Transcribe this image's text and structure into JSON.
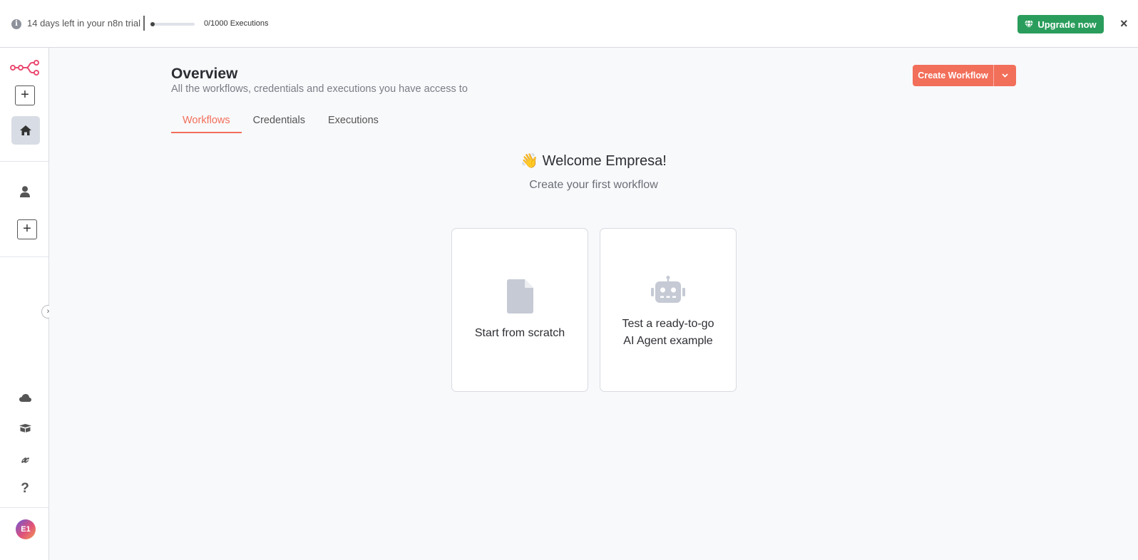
{
  "banner": {
    "trial_text": "14 days left in your n8n trial",
    "executions_text": "0/1000 Executions",
    "executions_used_fraction": 0.0,
    "upgrade_label": "Upgrade now",
    "close_label": "×",
    "upgrade_color": "#2a9d5c"
  },
  "sidebar": {
    "logo_icon": "n8n-logo-icon",
    "items": [
      {
        "icon": "plus-icon"
      },
      {
        "icon": "home-icon"
      },
      {
        "icon": "user-icon"
      },
      {
        "icon": "plus-icon"
      },
      {
        "icon": "cloud-icon"
      },
      {
        "icon": "package-icon"
      },
      {
        "icon": "variable-icon"
      },
      {
        "icon": "help-icon"
      }
    ],
    "avatar_initials": "E1"
  },
  "header": {
    "title": "Overview",
    "subtitle": "All the workflows, credentials and executions you have access to",
    "create_label": "Create Workflow",
    "accent_color": "#f26f5a"
  },
  "tabs": [
    {
      "label": "Workflows",
      "active": true
    },
    {
      "label": "Credentials",
      "active": false
    },
    {
      "label": "Executions",
      "active": false
    }
  ],
  "welcome": {
    "title": "👋 Welcome Empresa!",
    "subtitle": "Create your first workflow"
  },
  "cards": [
    {
      "line1": "Start from scratch",
      "icon": "file-icon"
    },
    {
      "line1": "Test a ready-to-go",
      "line2": "AI Agent example",
      "icon": "robot-icon"
    }
  ]
}
